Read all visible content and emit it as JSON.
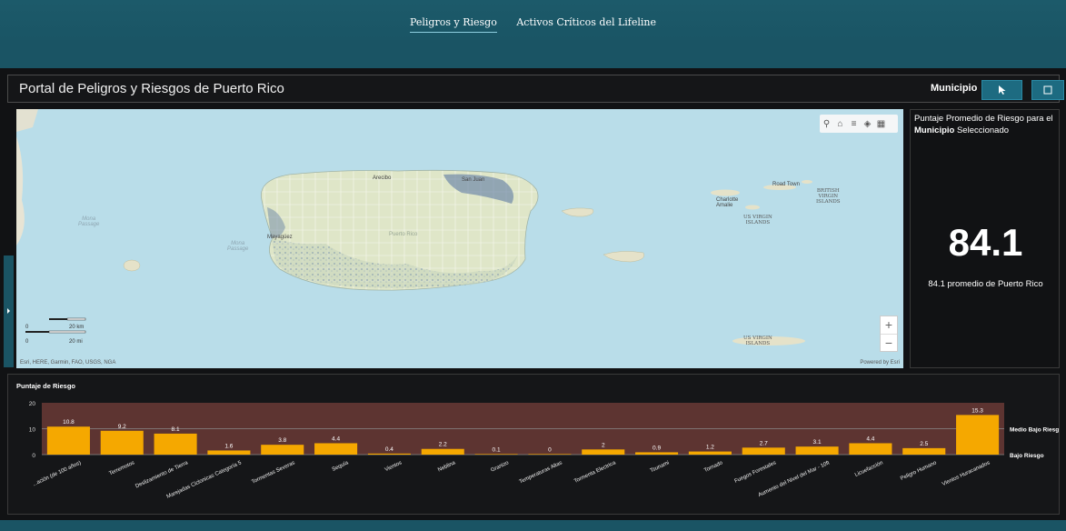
{
  "nav": {
    "tabs": [
      {
        "label": "Peligros y Riesgo",
        "active": true
      },
      {
        "label": "Activos Críticos del Lifeline",
        "active": false
      }
    ]
  },
  "header": {
    "title": "Portal de Peligros y Riesgos de Puerto Rico",
    "municipio_label": "Municipio"
  },
  "map": {
    "labels": {
      "mona_passage_1": "Mona\nPassage",
      "mona_passage_2": "Mona\nPassage",
      "san_juan": "San Juan",
      "arecibo": "Arecibo",
      "mayaguez": "Mayagüez",
      "ponce_area": "Puerto Rico",
      "charlotte_amalie": "Charlotte\nAmalie",
      "road_town": "Road Town",
      "us_virgin_islands_1": "US VIRGIN\nISLANDS",
      "us_virgin_islands_2": "US VIRGIN\nISLANDS",
      "british_virgin_islands": "BRITISH\nVIRGIN\nISLANDS"
    },
    "scale_km": "20 km",
    "scale_mi": "20 mi",
    "scale_zero_1": "0",
    "scale_zero_2": "0",
    "attribution": "Esri, HERE, Garmin, FAO, USGS, NGA",
    "powered_by": "Powered by Esri",
    "tools": [
      "search-icon",
      "home-icon",
      "list-icon",
      "layers-icon",
      "basemap-icon"
    ]
  },
  "risk_panel": {
    "title_part1": "Puntaje Promedio de Riesgo para el",
    "title_bold": "Municipio",
    "title_part2": "Seleccionado",
    "score": "84.1",
    "average_text": "84.1 promedio de Puerto Rico"
  },
  "chart_data": {
    "type": "bar",
    "title": "Puntaje de Riesgo",
    "categories": [
      "...ación (de 100 años)",
      "Terremotos",
      "Deslizamiento de Tierra",
      "Marejadas Ciclonicas Categoría 5",
      "Tormentas Severas",
      "Sequía",
      "Vientos",
      "Neblina",
      "Granizo",
      "Temperaturas Altas",
      "Tormenta Electrica",
      "Tsunami",
      "Tornado",
      "Fuegos Forestales",
      "Aumento del Nivel del Mar - 10ft",
      "Licuefacción",
      "Peligro Humano",
      "Vientos Huracanados"
    ],
    "values": [
      10.8,
      9.2,
      8.1,
      1.6,
      3.8,
      4.4,
      0.4,
      2.2,
      0.1,
      0,
      2,
      0.9,
      1.2,
      2.7,
      3.1,
      4.4,
      2.5,
      15.3
    ],
    "value_labels": [
      "10.8",
      "9.2",
      "8.1",
      "1.6",
      "3.8",
      "4.4",
      "0.4",
      "2.2",
      "0.1",
      "0",
      "2",
      "0.9",
      "1.2",
      "2.7",
      "3.1",
      "4.4",
      "2.5",
      "15.3"
    ],
    "ylim": [
      0,
      20
    ],
    "yticks": [
      0,
      10,
      20
    ],
    "bands": [
      {
        "label": "Medio Bajo Riesgo",
        "y": 10
      },
      {
        "label": "Bajo Riesgo",
        "y": 0
      }
    ],
    "bar_color": "#f5a800",
    "band_color": "#6a3a36"
  }
}
